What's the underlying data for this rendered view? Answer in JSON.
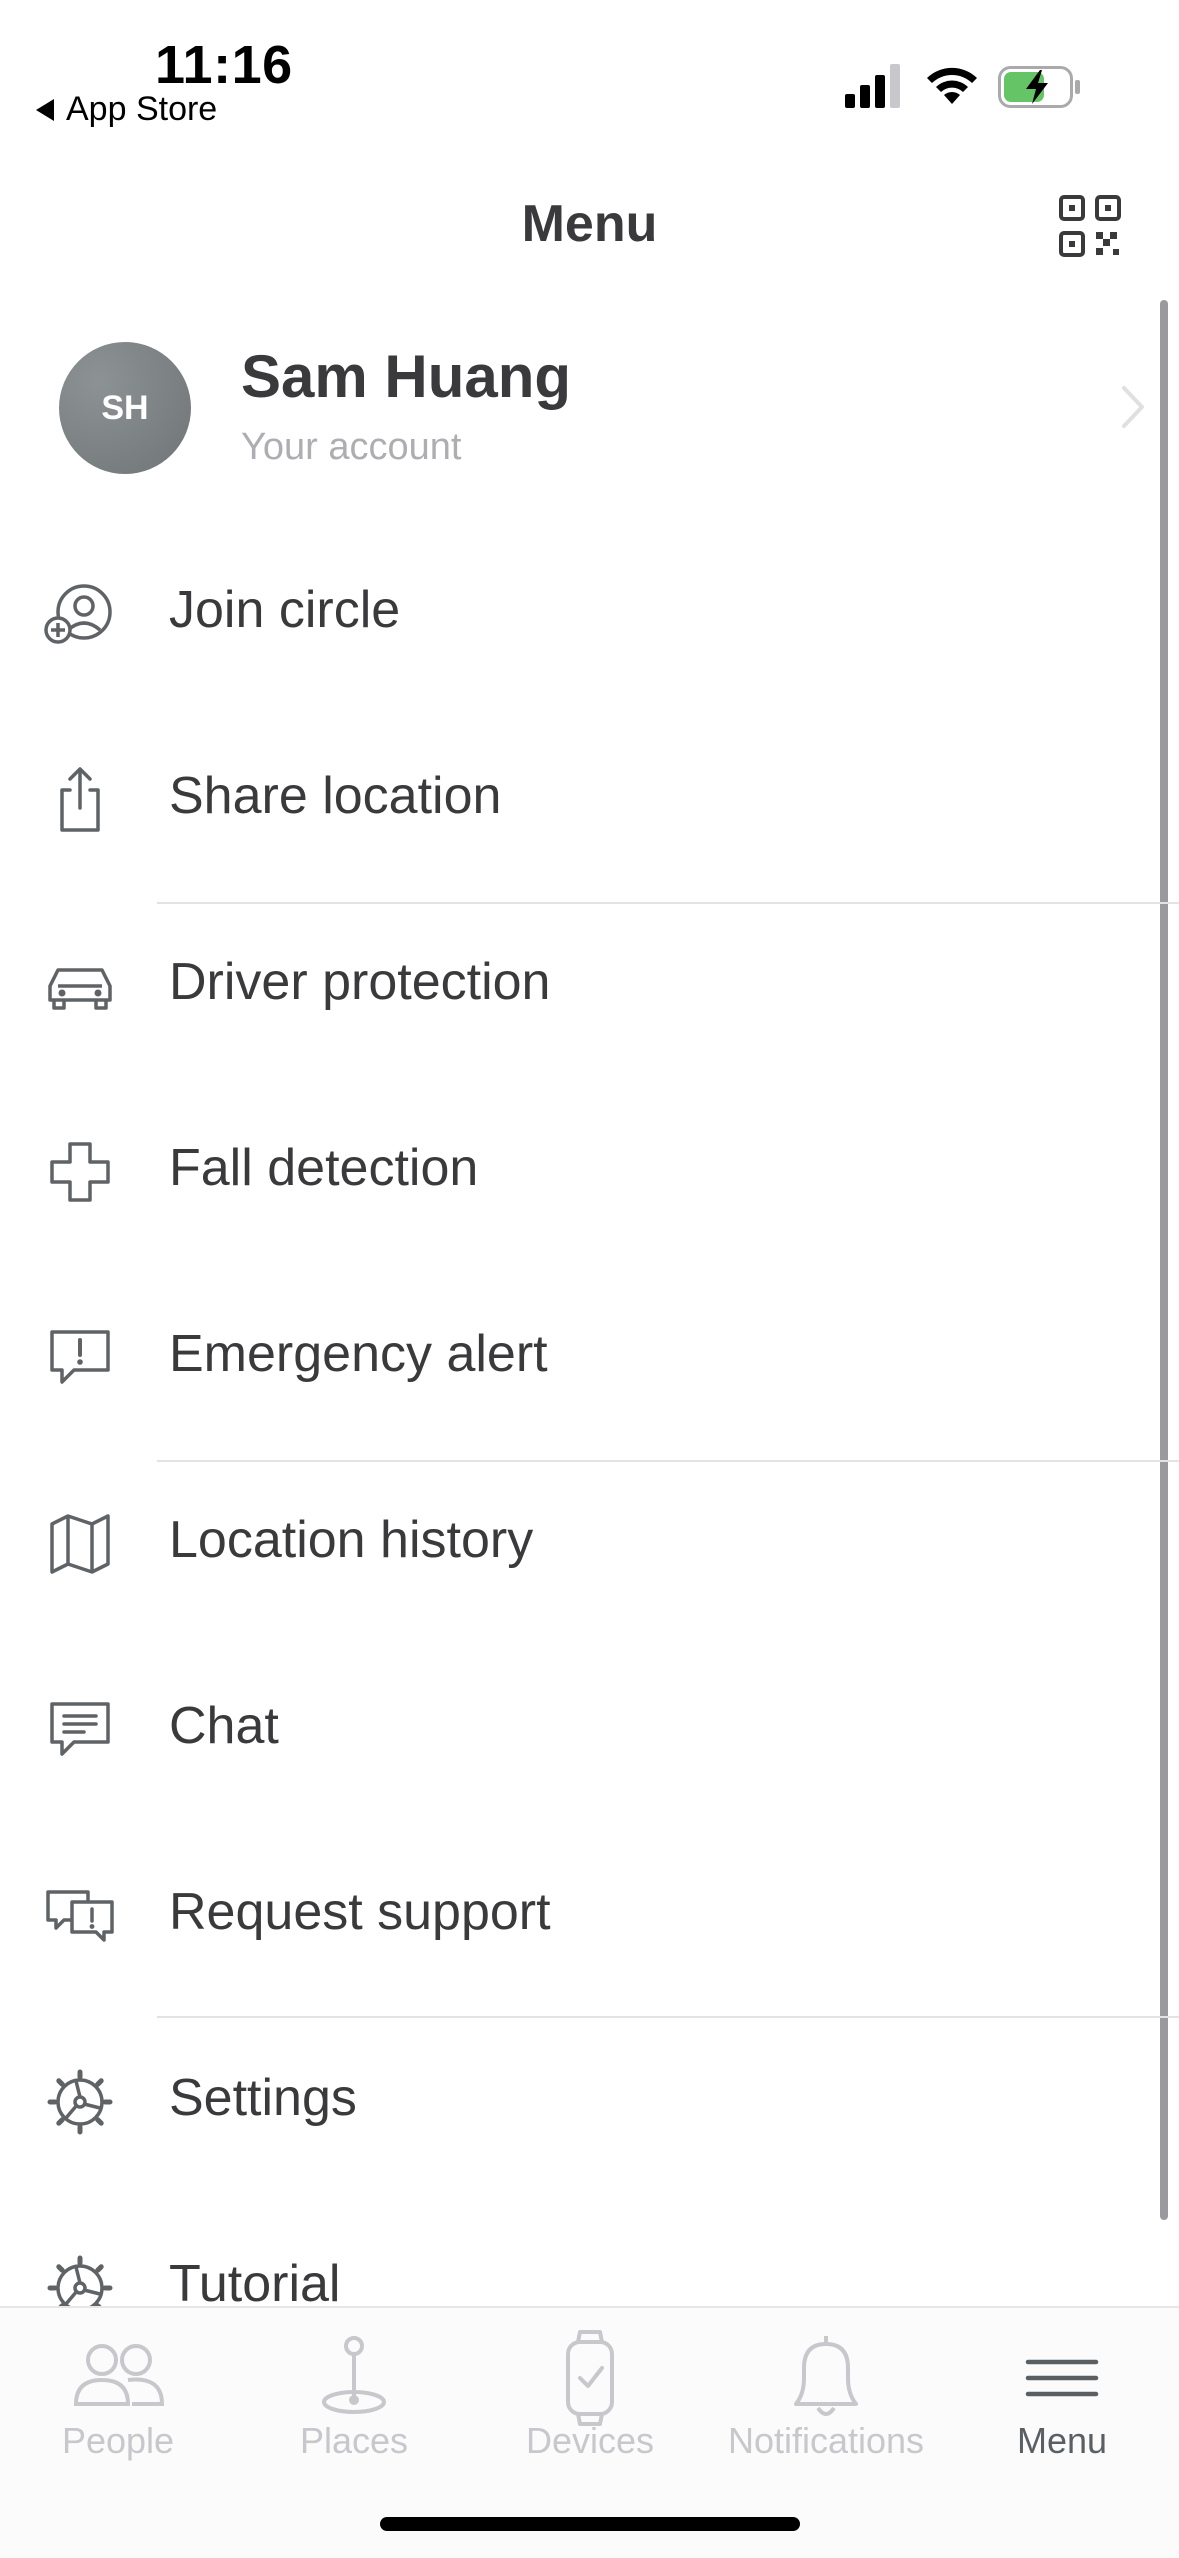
{
  "status_bar": {
    "time": "11:16",
    "back_label": "App Store"
  },
  "header": {
    "title": "Menu",
    "qr_icon": "qr-code-icon"
  },
  "account": {
    "initials": "SH",
    "name": "Sam Huang",
    "subtitle": "Your account"
  },
  "menu": {
    "items": [
      {
        "label": "Join circle",
        "icon": "join-circle-icon"
      },
      {
        "label": "Share location",
        "icon": "share-icon"
      },
      {
        "label": "Driver protection",
        "icon": "car-icon"
      },
      {
        "label": "Fall detection",
        "icon": "cross-icon"
      },
      {
        "label": "Emergency alert",
        "icon": "alert-bubble-icon"
      },
      {
        "label": "Location history",
        "icon": "map-icon"
      },
      {
        "label": "Chat",
        "icon": "chat-icon"
      },
      {
        "label": "Request support",
        "icon": "support-icon"
      },
      {
        "label": "Settings",
        "icon": "gear-icon"
      },
      {
        "label": "Tutorial",
        "icon": "gear-icon"
      }
    ]
  },
  "tab_bar": {
    "tabs": [
      {
        "label": "People",
        "icon": "people-icon",
        "active": false
      },
      {
        "label": "Places",
        "icon": "pin-icon",
        "active": false
      },
      {
        "label": "Devices",
        "icon": "watch-icon",
        "active": false
      },
      {
        "label": "Notifications",
        "icon": "bell-icon",
        "active": false
      },
      {
        "label": "Menu",
        "icon": "hamburger-icon",
        "active": true
      }
    ]
  },
  "colors": {
    "text_primary": "#3a3a3c",
    "text_secondary": "#aeaeb2",
    "tab_inactive": "#c7c7cc",
    "tab_active": "#5a5f64",
    "battery_charging": "#65c466"
  }
}
